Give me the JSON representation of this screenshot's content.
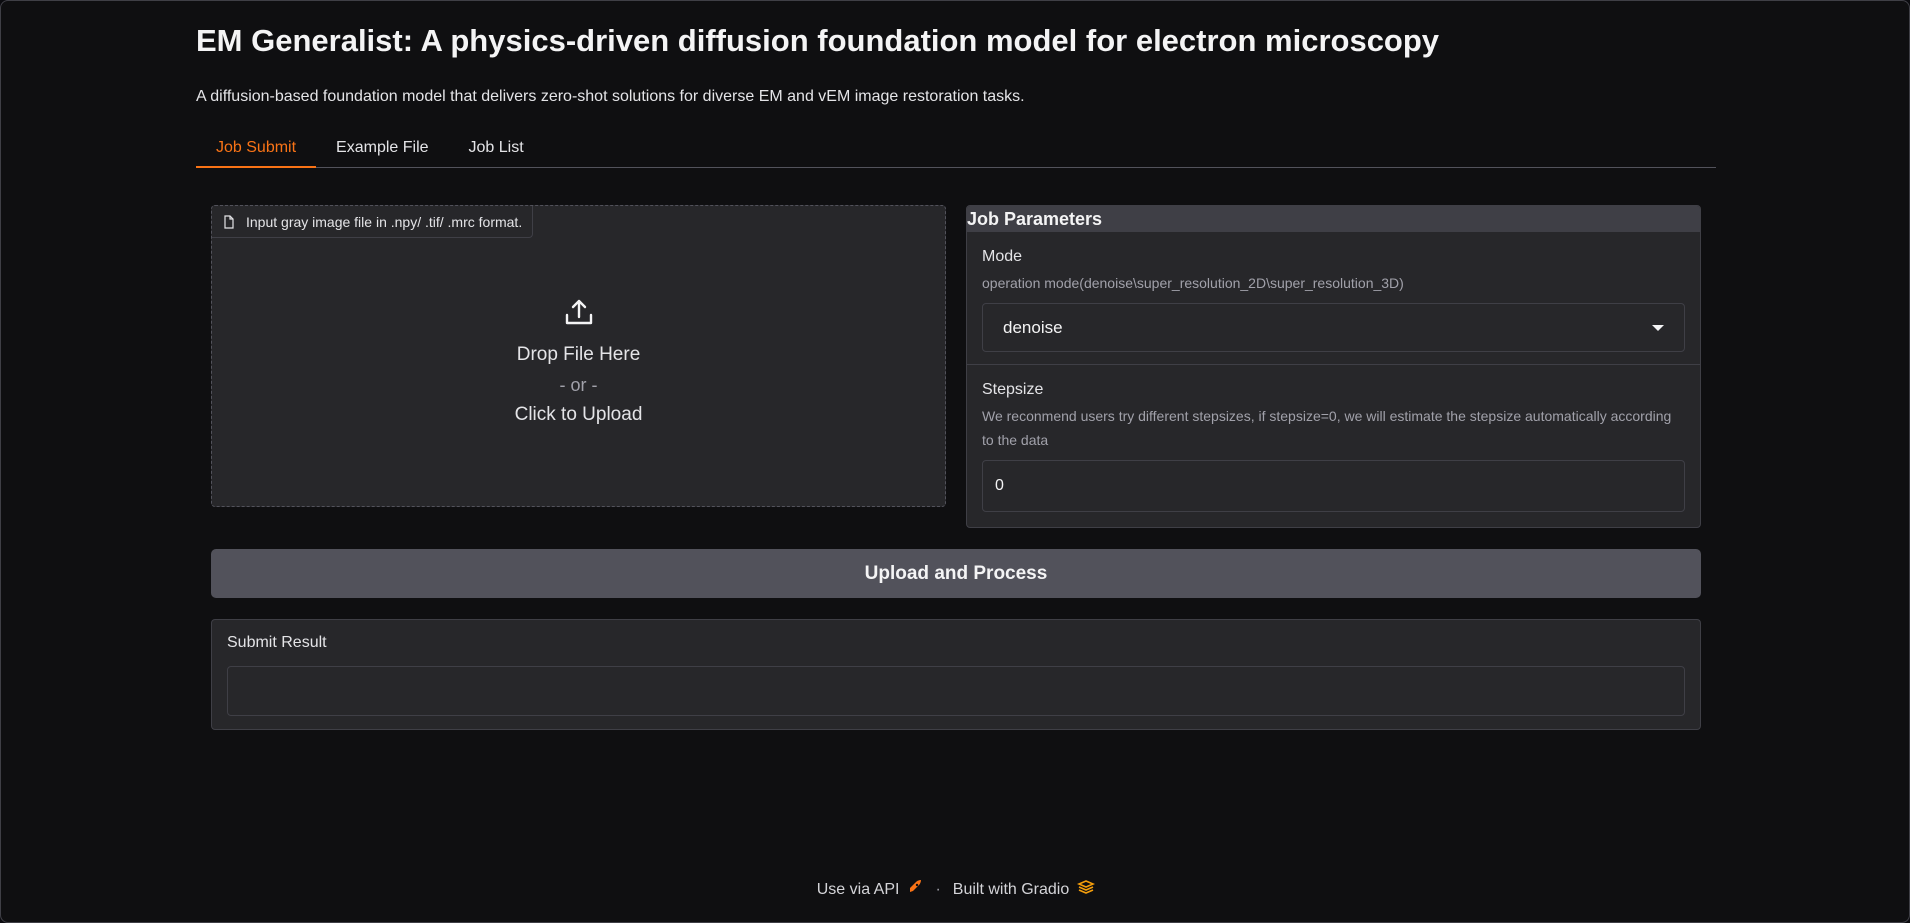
{
  "header": {
    "title": "EM Generalist: A physics-driven diffusion foundation model for electron microscopy",
    "subtitle": "A diffusion-based foundation model that delivers zero-shot solutions for diverse EM and vEM image restoration tasks."
  },
  "tabs": [
    {
      "label": "Job Submit",
      "active": true
    },
    {
      "label": "Example File",
      "active": false
    },
    {
      "label": "Job List",
      "active": false
    }
  ],
  "upload": {
    "label": "Input gray image file in .npy/ .tif/ .mrc format.",
    "drop_text": "Drop File Here",
    "or_text": "- or -",
    "click_text": "Click to Upload"
  },
  "params": {
    "header": "Job Parameters",
    "mode": {
      "label": "Mode",
      "info": "operation mode(denoise\\super_resolution_2D\\super_resolution_3D)",
      "value": "denoise"
    },
    "stepsize": {
      "label": "Stepsize",
      "info": "We reconmend users try different stepsizes, if stepsize=0, we will estimate the stepsize automatically according to the data",
      "value": "0"
    }
  },
  "process_button": "Upload and Process",
  "result": {
    "label": "Submit Result",
    "value": ""
  },
  "footer": {
    "api_link": "Use via API",
    "separator": "·",
    "built_with": "Built with Gradio"
  },
  "colors": {
    "accent": "#f97316",
    "background": "#0f0f11",
    "panel": "#27272a"
  },
  "icons": [
    "file-icon",
    "upload-icon",
    "chevron-down-icon",
    "rocket-icon",
    "gradio-logo-icon"
  ]
}
